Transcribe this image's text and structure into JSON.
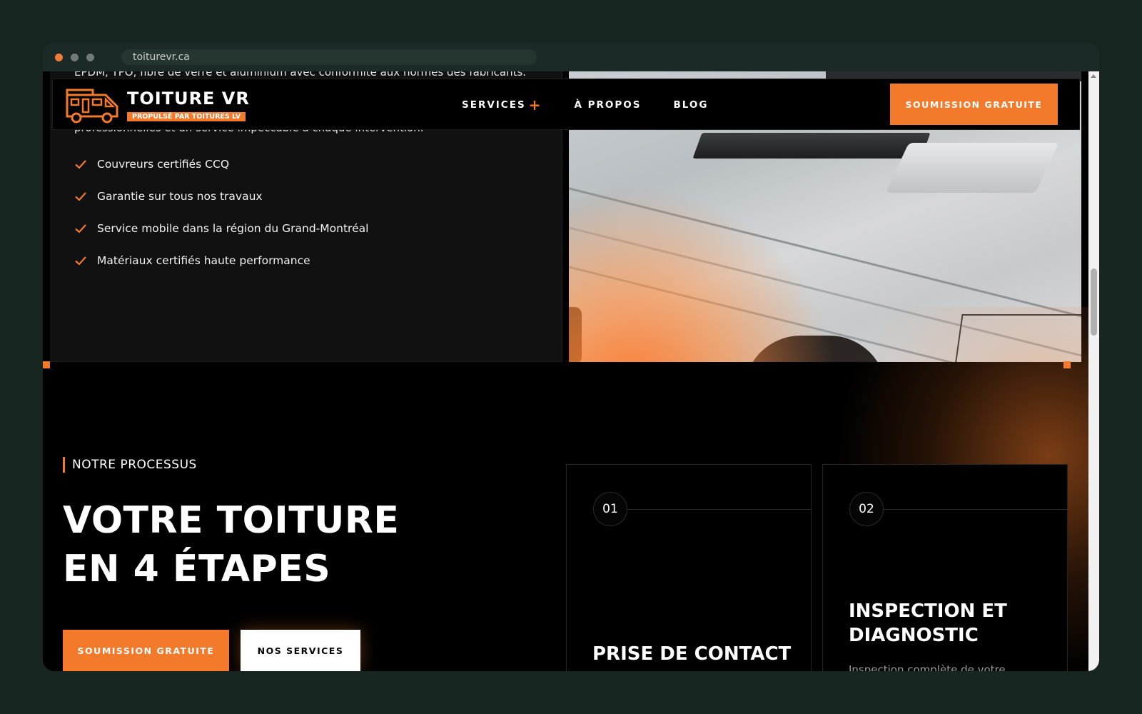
{
  "browser": {
    "url": "toiturevr.ca"
  },
  "intro": {
    "partial_line_top": "EPDM, TPO, fibre de verre et aluminium avec conformité aux normes des fabricants.",
    "partial_line_bottom": "professionnelles et un service impeccable à chaque intervention.",
    "checklist": [
      "Couvreurs certifiés CCQ",
      "Garantie sur tous nos travaux",
      "Service mobile dans la région du Grand-Montréal",
      "Matériaux certifiés haute performance"
    ]
  },
  "nav": {
    "logo_title": "TOITURE VR",
    "logo_subtitle": "PROPULSÉ PAR TOITURES LV",
    "links": {
      "services": "SERVICES",
      "services_plus": "+",
      "about": "À PROPOS",
      "blog": "BLOG"
    },
    "cta": "SOUMISSION GRATUITE"
  },
  "process": {
    "eyebrow": "NOTRE PROCESSUS",
    "heading_line1": "VOTRE TOITURE",
    "heading_line2": "EN 4 ÉTAPES",
    "primary_button": "SOUMISSION GRATUITE",
    "secondary_button": "NOS SERVICES",
    "steps": [
      {
        "number": "01",
        "title": "PRISE DE CONTACT",
        "description": ""
      },
      {
        "number": "02",
        "title_line1": "INSPECTION ET",
        "title_line2": "DIAGNOSTIC",
        "description": "Inspection complète de votre"
      }
    ]
  },
  "colors": {
    "accent": "#f47a2b",
    "background": "#000000",
    "panel": "#111111"
  }
}
